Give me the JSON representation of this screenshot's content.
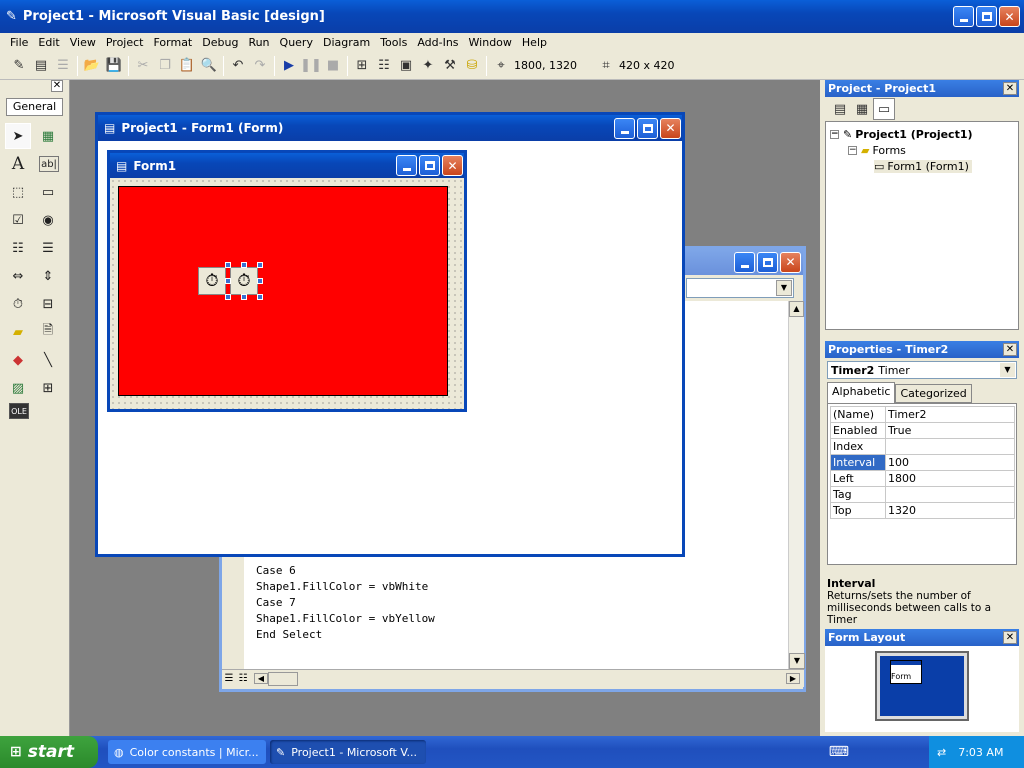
{
  "app": {
    "title": "Project1 - Microsoft Visual Basic [design]"
  },
  "menu": [
    "File",
    "Edit",
    "View",
    "Project",
    "Format",
    "Debug",
    "Run",
    "Query",
    "Diagram",
    "Tools",
    "Add-Ins",
    "Window",
    "Help"
  ],
  "toolbar": {
    "position": "1800, 1320",
    "size": "420 x 420"
  },
  "toolbox": {
    "tab_label": "General",
    "icons": [
      "pointer-icon",
      "picturebox-icon",
      "label-icon",
      "textbox-icon",
      "frame-icon",
      "commandbutton-icon",
      "checkbox-icon",
      "optionbutton-icon",
      "combobox-icon",
      "listbox-icon",
      "hscrollbar-icon",
      "vscrollbar-icon",
      "timer-icon",
      "drivelistbox-icon",
      "dirlistbox-icon",
      "filelistbox-icon",
      "shape-icon",
      "line-icon",
      "image-icon",
      "data-icon",
      "ole-icon"
    ]
  },
  "designer": {
    "title": "Project1 - Form1 (Form)",
    "form_title": "Form1",
    "shape_color": "#ff0000"
  },
  "code_window": {
    "lines": [
      "Case 6",
      "Shape1.FillColor = vbWhite",
      "Case 7",
      "Shape1.FillColor = vbYellow",
      "End Select"
    ]
  },
  "project": {
    "title": "Project - Project1",
    "root": "Project1 (Project1)",
    "folder": "Forms",
    "item": "Form1 (Form1)"
  },
  "properties": {
    "title": "Properties - Timer2",
    "object_name": "Timer2",
    "object_type": "Timer",
    "tab_alpha": "Alphabetic",
    "tab_cat": "Categorized",
    "rows": [
      {
        "name": "(Name)",
        "value": "Timer2"
      },
      {
        "name": "Enabled",
        "value": "True"
      },
      {
        "name": "Index",
        "value": ""
      },
      {
        "name": "Interval",
        "value": "100"
      },
      {
        "name": "Left",
        "value": "1800"
      },
      {
        "name": "Tag",
        "value": ""
      },
      {
        "name": "Top",
        "value": "1320"
      }
    ],
    "desc_title": "Interval",
    "desc_text": "Returns/sets the number of milliseconds between calls to a Timer"
  },
  "form_layout": {
    "title": "Form Layout",
    "preview_label": "Form"
  },
  "taskbar": {
    "start": "start",
    "tasks": [
      "Color constants | Micr...",
      "Project1 - Microsoft V..."
    ],
    "clock": "7:03 AM"
  }
}
